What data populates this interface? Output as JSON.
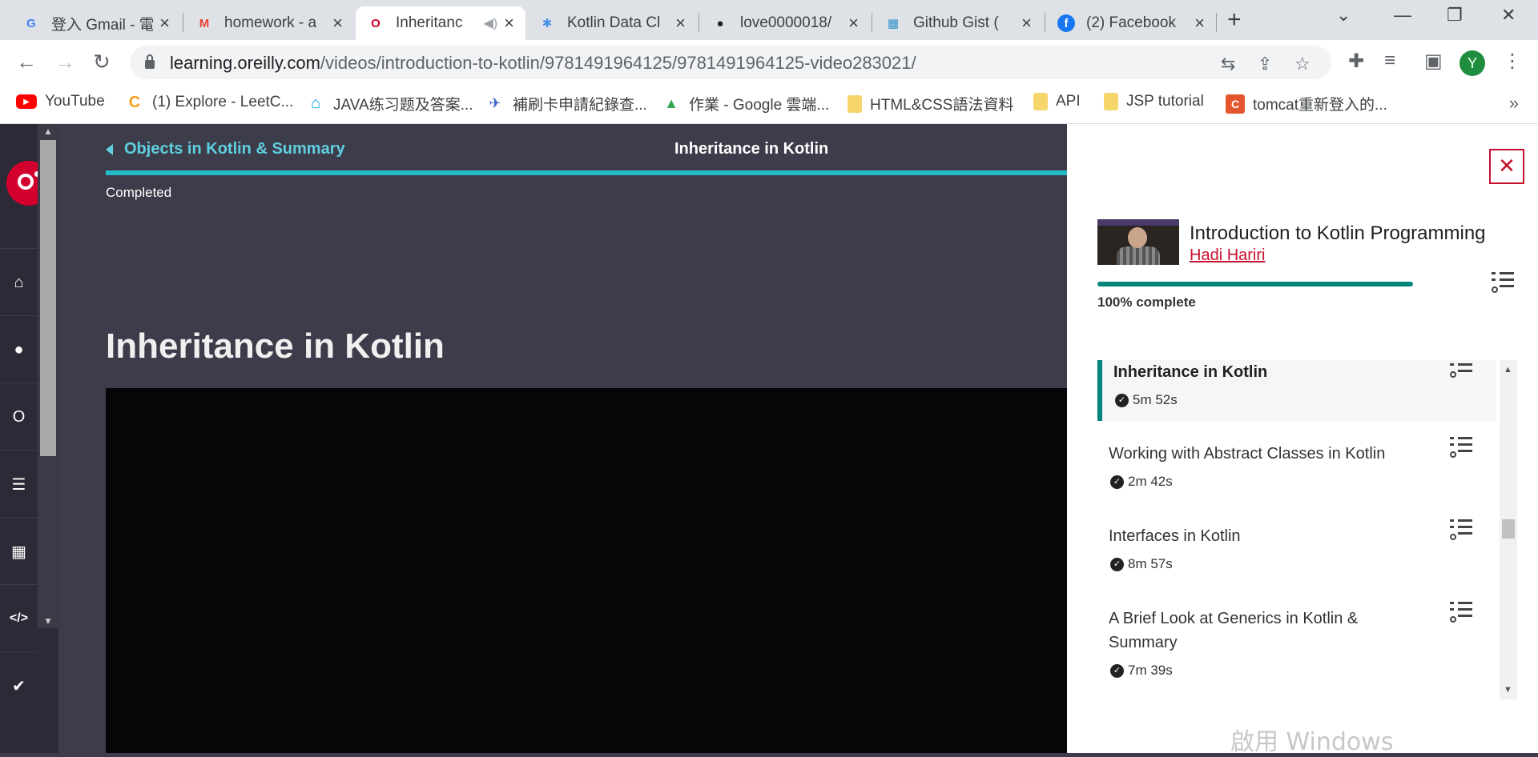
{
  "browser": {
    "tabs": [
      {
        "label": "登入 Gmail - 電",
        "icon": "G",
        "icon_color": "#4285f4"
      },
      {
        "label": "homework - a",
        "icon": "M",
        "icon_color": "#ea4335"
      },
      {
        "label": "Inheritanc",
        "icon": "O",
        "icon_color": "#d3002d",
        "active": true
      },
      {
        "label": "Kotlin Data Cl",
        "icon": "✱",
        "icon_color": "#4a8fe7"
      },
      {
        "label": "love0000018/",
        "icon": "●",
        "icon_color": "#1b1f23"
      },
      {
        "label": "Github Gist (",
        "icon": "▦",
        "icon_color": "#2f8fc9"
      },
      {
        "label": "(2) Facebook",
        "icon": "f",
        "icon_color": "#1877f2"
      }
    ],
    "new_tab": "+",
    "url_domain": "learning.oreilly.com",
    "url_path": "/videos/introduction-to-kotlin/9781491964125/9781491964125-video283021/",
    "avatar_letter": "Y",
    "bookmarks": [
      {
        "label": "YouTube",
        "icon": "▶",
        "color": "#ff0000"
      },
      {
        "label": "(1) Explore - LeetC...",
        "icon": "C",
        "color": "#f89f1b"
      },
      {
        "label": "JAVA练习题及答案...",
        "icon": "⌂",
        "color": "#00a1d6"
      },
      {
        "label": "補刷卡申請紀錄查...",
        "icon": "✈",
        "color": "#3366cc"
      },
      {
        "label": "作業 - Google 雲端...",
        "icon": "▲",
        "color": "#34a853"
      },
      {
        "label": "HTML&CSS語法資料",
        "icon": "",
        "color": "#f6d56b"
      },
      {
        "label": "API",
        "icon": "",
        "color": "#f6d56b"
      },
      {
        "label": "JSP tutorial",
        "icon": "",
        "color": "#f6d56b"
      },
      {
        "label": "tomcat重新登入的...",
        "icon": "C",
        "color": "#e4572e"
      }
    ],
    "bookmarks_more": "»"
  },
  "header": {
    "back_label": "Objects in Kotlin & Summary",
    "current_title": "Inheritance in Kotlin",
    "status": "Completed"
  },
  "main": {
    "title": "Inheritance in Kotlin"
  },
  "panel": {
    "close": "✕",
    "course_title": "Introduction to Kotlin Programming",
    "author": "Hadi Hariri",
    "progress_fraction": 1.0,
    "progress_label": "100% complete",
    "toc": [
      {
        "title": "Inheritance in Kotlin",
        "duration": "5m 52s",
        "active": true
      },
      {
        "title": "Working with Abstract Classes in Kotlin",
        "duration": "2m 42s"
      },
      {
        "title": "Interfaces in Kotlin",
        "duration": "8m 57s"
      },
      {
        "title": "A Brief Look at Generics in Kotlin & Summary",
        "duration": "7m 39s"
      }
    ]
  },
  "watermark": "啟用 Windows",
  "colors": {
    "accent_teal": "#23bcc6",
    "progress_green": "#00857c",
    "oreilly_red": "#d3002d",
    "link_red": "#c8102e"
  }
}
